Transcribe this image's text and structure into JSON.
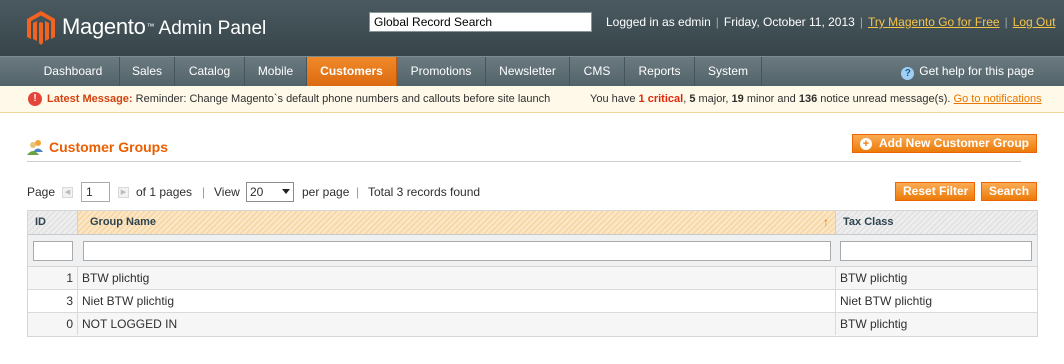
{
  "header": {
    "brand": "Magento",
    "tm": "™",
    "subtitle": "Admin Panel",
    "search_value": "Global Record Search",
    "logged_in": "Logged in as edmin",
    "date": "Friday, October 11, 2013",
    "try_link": "Try Magento Go for Free",
    "logout": "Log Out"
  },
  "nav": {
    "items": [
      "Dashboard",
      "Sales",
      "Catalog",
      "Mobile",
      "Customers",
      "Promotions",
      "Newsletter",
      "CMS",
      "Reports",
      "System"
    ],
    "active": "Customers",
    "help": "Get help for this page"
  },
  "message": {
    "label": "Latest Message:",
    "text": "Reminder: Change Magento`s default phone numbers and callouts before site launch",
    "prefix": "You have",
    "critical": "1 critical",
    "major": "5",
    "major_label": "major,",
    "minor": "19",
    "minor_label": "minor and",
    "notice": "136",
    "notice_label": "notice unread message(s).",
    "link": "Go to notifications"
  },
  "page": {
    "title": "Customer Groups",
    "add_button": "Add New Customer Group",
    "reset_button": "Reset Filter",
    "search_button": "Search"
  },
  "pager": {
    "page_label": "Page",
    "page_value": "1",
    "of_pages": "of 1 pages",
    "view_label": "View",
    "per_page_value": "20",
    "per_page_label": "per page",
    "total": "Total 3 records found"
  },
  "grid": {
    "columns": [
      "ID",
      "Group Name",
      "Tax Class"
    ],
    "rows": [
      {
        "id": "1",
        "name": "BTW plichtig",
        "tax": "BTW plichtig"
      },
      {
        "id": "3",
        "name": "Niet BTW plichtig",
        "tax": "Niet BTW plichtig"
      },
      {
        "id": "0",
        "name": "NOT LOGGED IN",
        "tax": "BTW plichtig"
      }
    ]
  },
  "colors": {
    "accent": "#eb5e00",
    "header_bg": "#3f4e54",
    "nav_active": "#e8781a"
  }
}
